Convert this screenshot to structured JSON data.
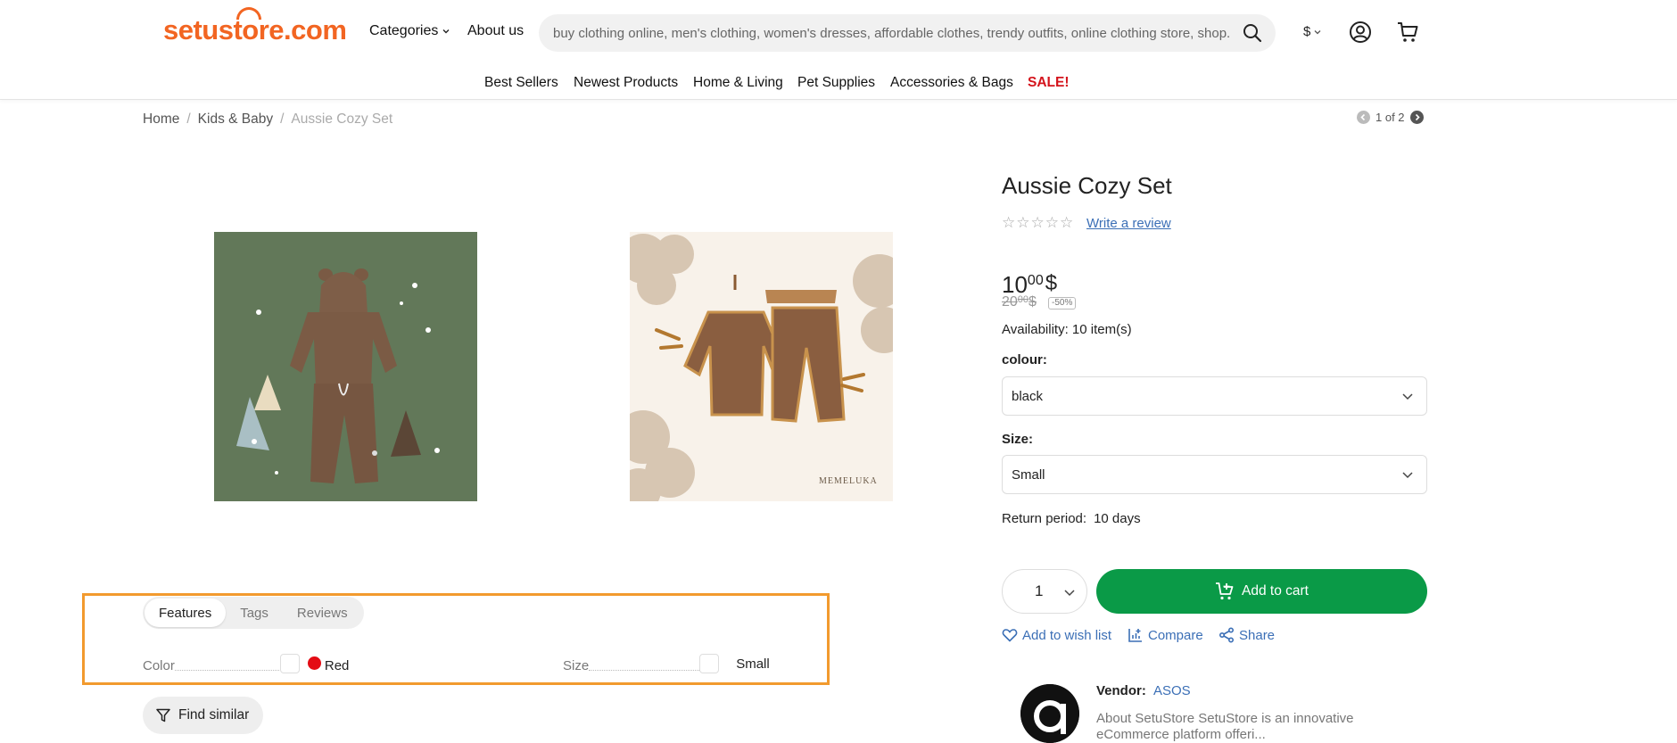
{
  "header": {
    "logo_text": "setustore.com",
    "nav_categories": "Categories",
    "nav_about": "About us",
    "search_placeholder": "buy clothing online, men's clothing, women's dresses, affordable clothes, trendy outfits, online clothing store, shop...",
    "currency": "$",
    "brand_color": "#f26522"
  },
  "nav": {
    "items": [
      "Best Sellers",
      "Newest Products",
      "Home & Living",
      "Pet Supplies",
      "Accessories & Bags"
    ],
    "sale": "SALE!"
  },
  "breadcrumb": {
    "home": "Home",
    "category": "Kids & Baby",
    "current": "Aussie Cozy Set",
    "pager": "1 of 2"
  },
  "images": {
    "second_brand": "MEMELUKA"
  },
  "tabs": {
    "items": [
      "Features",
      "Tags",
      "Reviews"
    ],
    "active": "Features"
  },
  "features": {
    "color_label": "Color",
    "color_value": "Red",
    "size_label": "Size",
    "size_value": "Small"
  },
  "find_similar": "Find similar",
  "product": {
    "title": "Aussie Cozy Set",
    "rating": 0,
    "review_link": "Write a review",
    "price_int": "10",
    "price_dec": "00",
    "price_currency": "$",
    "old_price_int": "20",
    "old_price_dec": "00",
    "old_price_currency": "$",
    "discount": "-50%",
    "availability": "Availability: 10 item(s)",
    "colour_label": "colour:",
    "colour_value": "black",
    "size_label": "Size:",
    "size_value": "Small",
    "return_label": "Return period:",
    "return_value": "10 days",
    "quantity": "1",
    "add_to_cart": "Add to cart",
    "cart_color": "#0a9a47",
    "wishlist": "Add to wish list",
    "compare": "Compare",
    "share": "Share"
  },
  "vendor": {
    "label": "Vendor:",
    "name": "ASOS",
    "about_line1": "About SetuStore SetuStore is an innovative",
    "about_line2": "eCommerce platform offeri..."
  }
}
